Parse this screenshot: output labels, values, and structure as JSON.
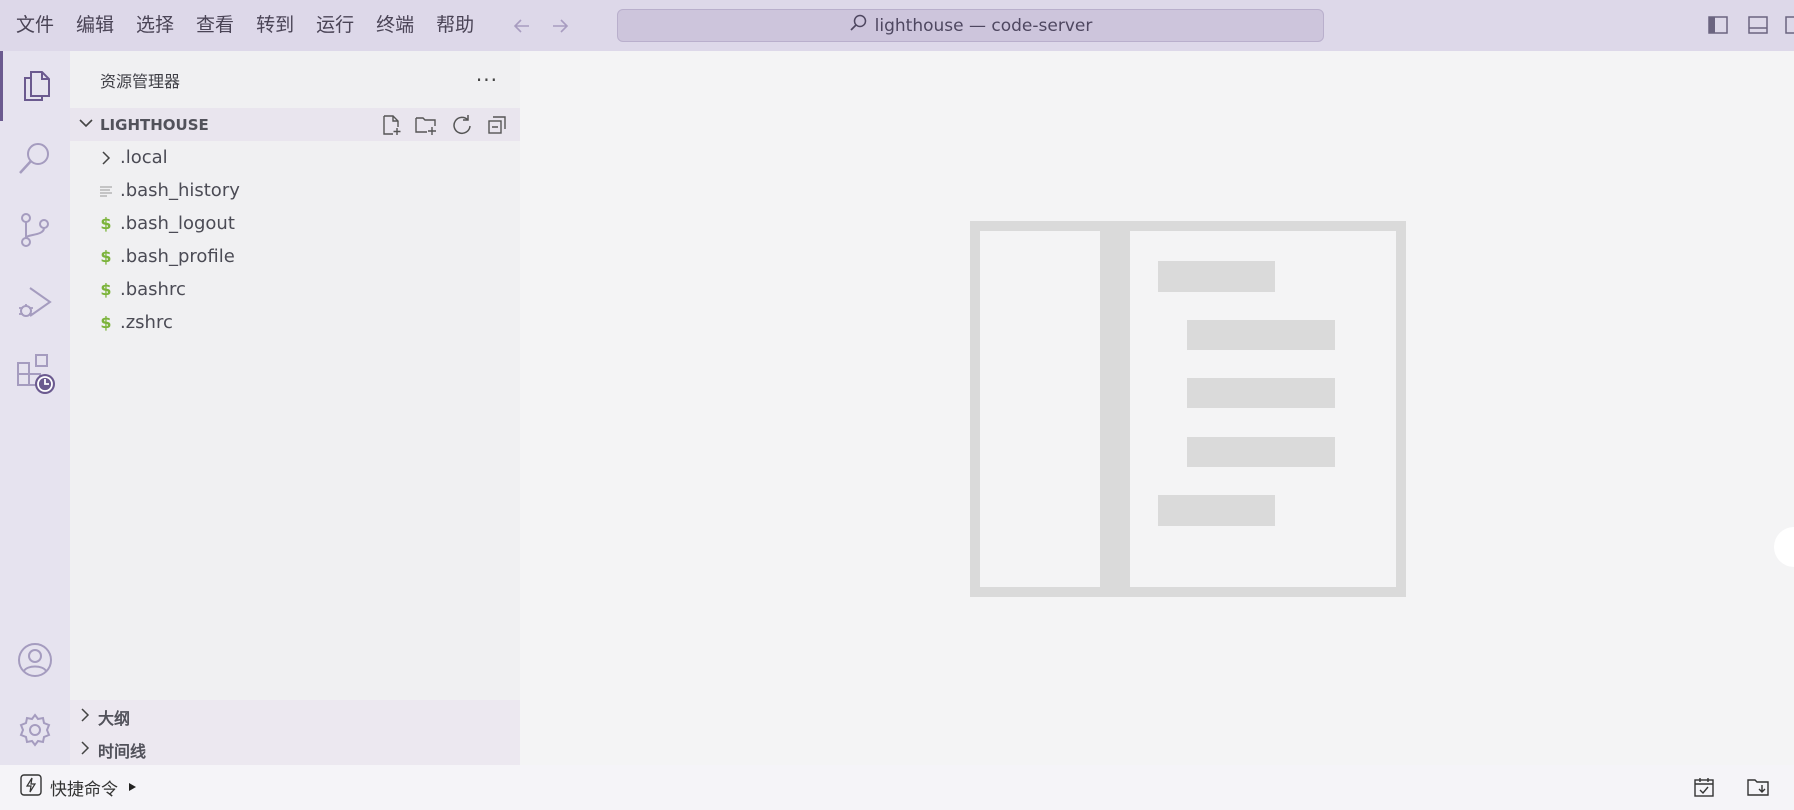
{
  "menu": [
    "文件",
    "编辑",
    "选择",
    "查看",
    "转到",
    "运行",
    "终端",
    "帮助"
  ],
  "search": {
    "text": "lighthouse — code-server",
    "icon": "search-icon"
  },
  "activity_bar": {
    "top": [
      "explorer-icon",
      "search-icon",
      "source-control-icon",
      "run-debug-icon",
      "extensions-icon"
    ],
    "bottom": [
      "account-icon",
      "settings-gear-icon"
    ]
  },
  "sidebar": {
    "title": "资源管理器",
    "more": "···",
    "section": {
      "title": "LIGHTHOUSE",
      "actions": [
        "new-file-icon",
        "new-folder-icon",
        "refresh-icon",
        "collapse-all-icon"
      ]
    },
    "files": [
      {
        "name": ".local",
        "icon": "chevron-right-icon"
      },
      {
        "name": ".bash_history",
        "icon": "text-file-icon"
      },
      {
        "name": ".bash_logout",
        "icon": "shell-script-icon",
        "glyph": "$"
      },
      {
        "name": ".bash_profile",
        "icon": "shell-script-icon",
        "glyph": "$"
      },
      {
        "name": ".bashrc",
        "icon": "shell-script-icon",
        "glyph": "$"
      },
      {
        "name": ".zshrc",
        "icon": "shell-script-icon",
        "glyph": "$"
      }
    ],
    "bottom_sections": [
      "大纲",
      "时间线"
    ]
  },
  "status_bar": {
    "quick_command": "快捷命令",
    "right_icons": [
      "calendar-check-icon",
      "folder-download-icon"
    ]
  },
  "colors": {
    "titlebar": "#ddd8e9",
    "activitybar": "#e6e3ef",
    "accent": "#6b5a8f",
    "shell_icon": "#7bb33a"
  }
}
